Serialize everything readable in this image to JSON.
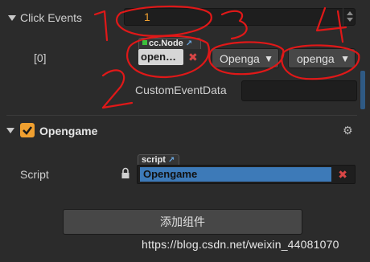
{
  "click_events": {
    "title": "Click Events",
    "count_value": "1",
    "index_label": "[0]",
    "node_tag": "cc.Node",
    "node_value": "open…",
    "component_select": "Openga",
    "handler_select": "openga",
    "custom_event_label": "CustomEventData",
    "custom_event_value": ""
  },
  "component": {
    "name": "Opengame",
    "enabled": true,
    "script_label": "Script",
    "script_tag": "script",
    "script_value": "Opengame"
  },
  "add_component_label": "添加组件",
  "watermark": "https://blog.csdn.net/weixin_44081070",
  "colors": {
    "background": "#2b2b2b",
    "input_bg": "#1e1e1e",
    "count_text": "#f0a030",
    "checkbox": "#f0a030",
    "script_field": "#3d7ab8",
    "remove": "#d94646",
    "annotation": "#e01818"
  },
  "icons": {
    "collapse": "triangle-down",
    "link": "external-link",
    "lock": "padlock",
    "settings": "gear",
    "remove": "x-mark",
    "node_status": "green-square"
  }
}
